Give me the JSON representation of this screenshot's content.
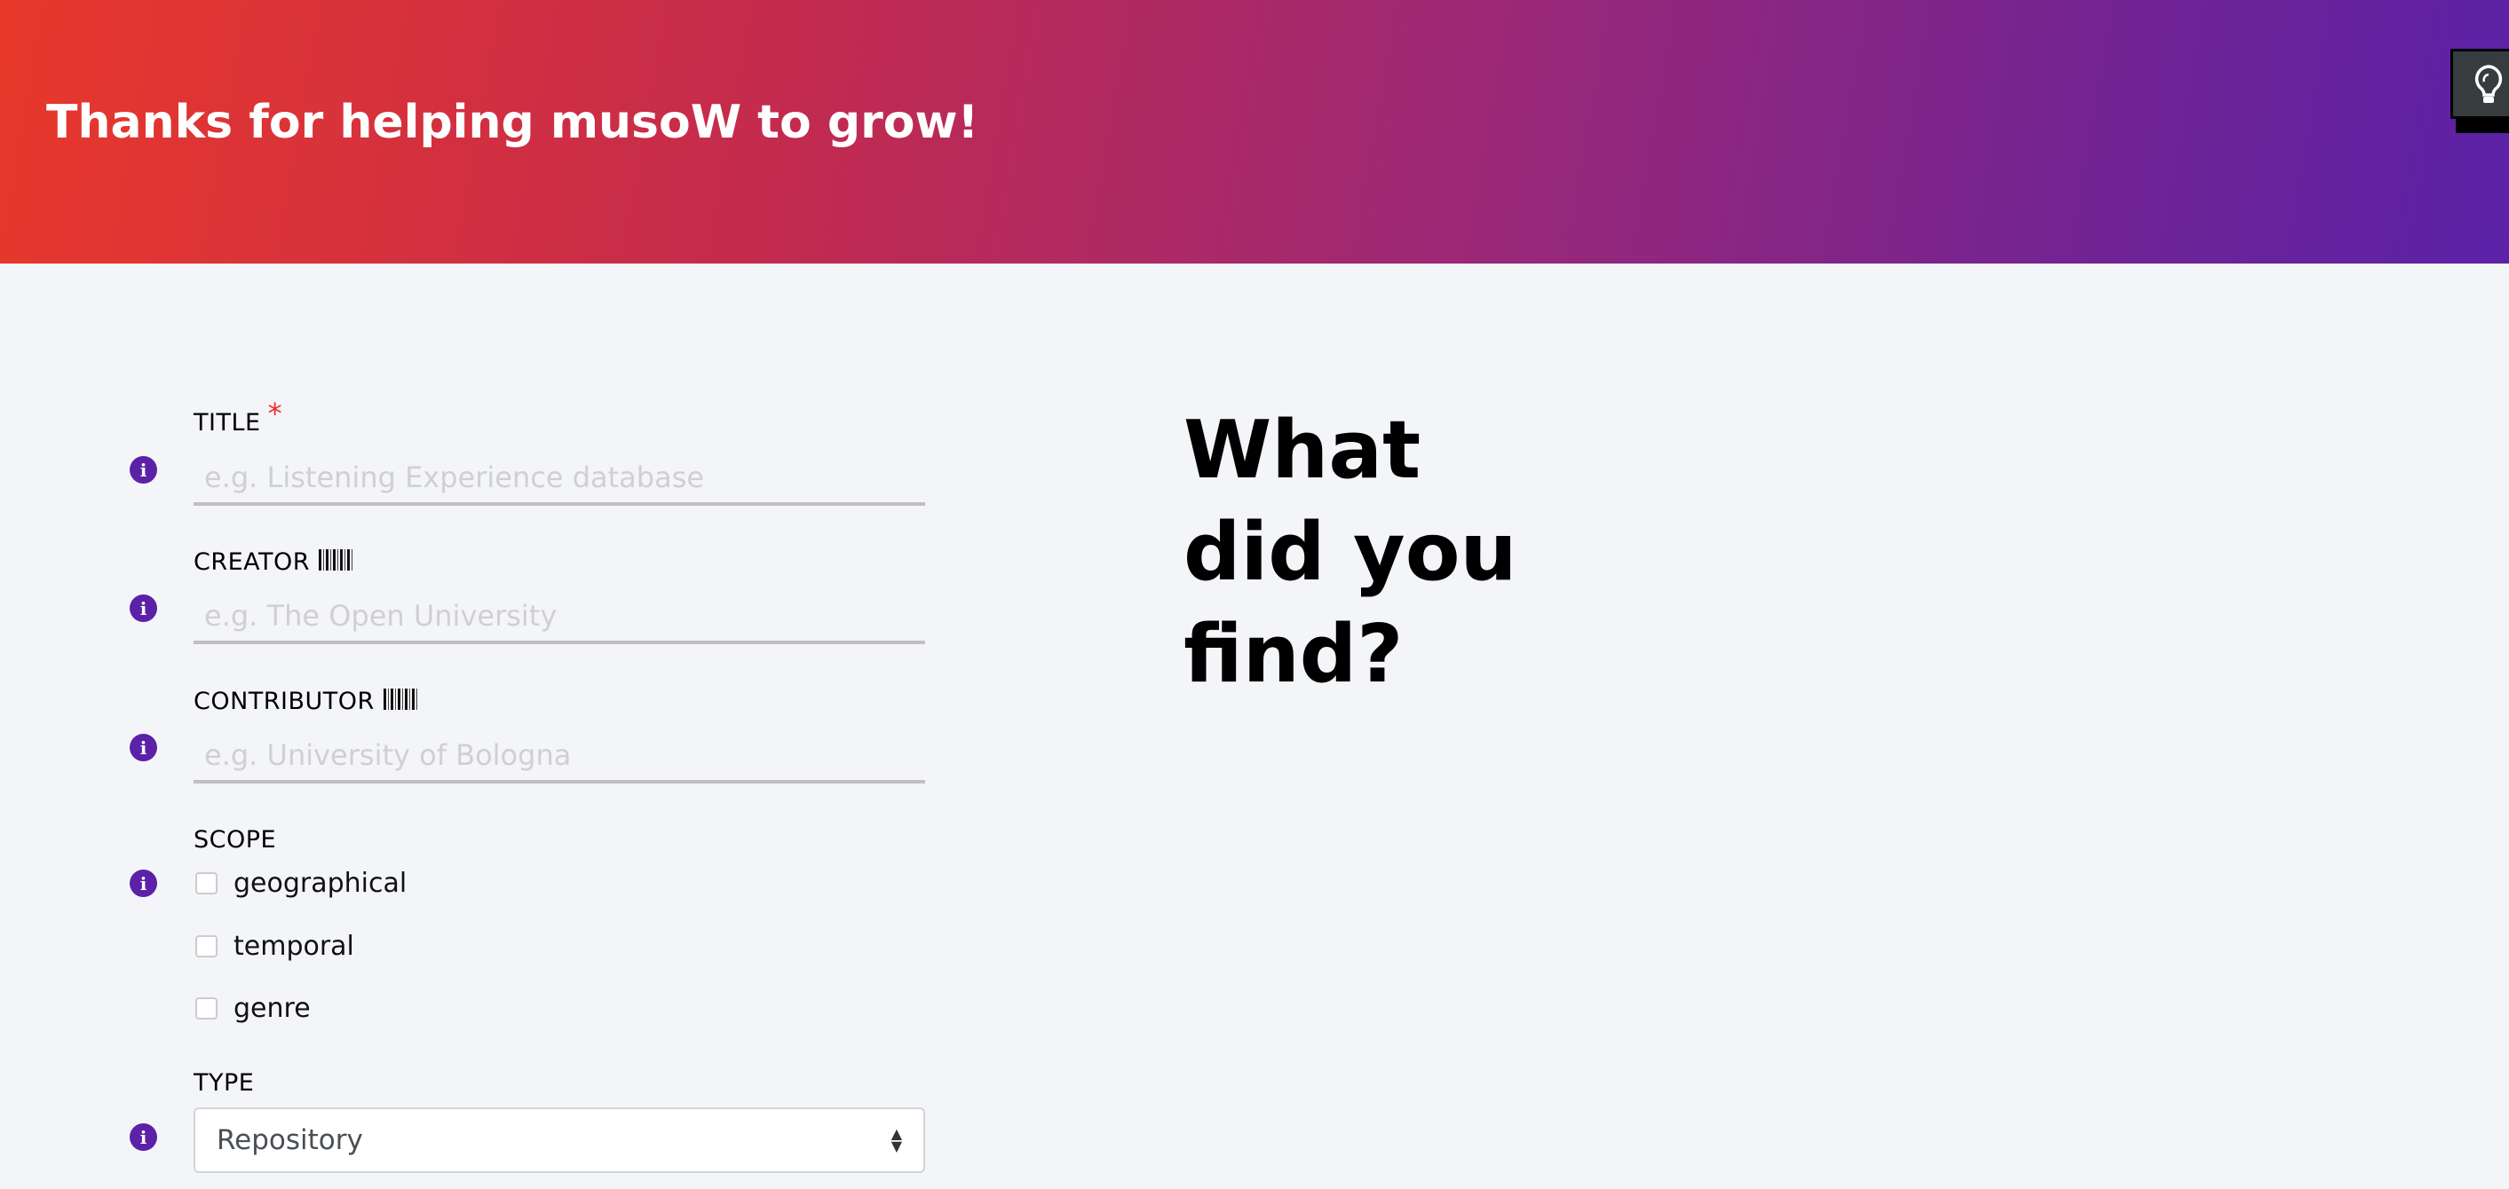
{
  "header": {
    "title": "Thanks for helping musoW to grow!",
    "tip_button_icon": "lightbulb-icon"
  },
  "form": {
    "title": {
      "label": "TITLE",
      "required_mark": "*",
      "placeholder": "e.g. Listening Experience database"
    },
    "creator": {
      "label": "CREATOR",
      "placeholder": "e.g. The Open University"
    },
    "contributor": {
      "label": "CONTRIBUTOR",
      "placeholder": "e.g. University of Bologna"
    },
    "scope": {
      "label": "SCOPE",
      "options": [
        "geographical",
        "temporal",
        "genre"
      ]
    },
    "type": {
      "label": "TYPE",
      "selected": "Repository"
    }
  },
  "main": {
    "heading": "What did you find?"
  },
  "colors": {
    "accent": "#5b22a8",
    "required": "#e8302a"
  }
}
